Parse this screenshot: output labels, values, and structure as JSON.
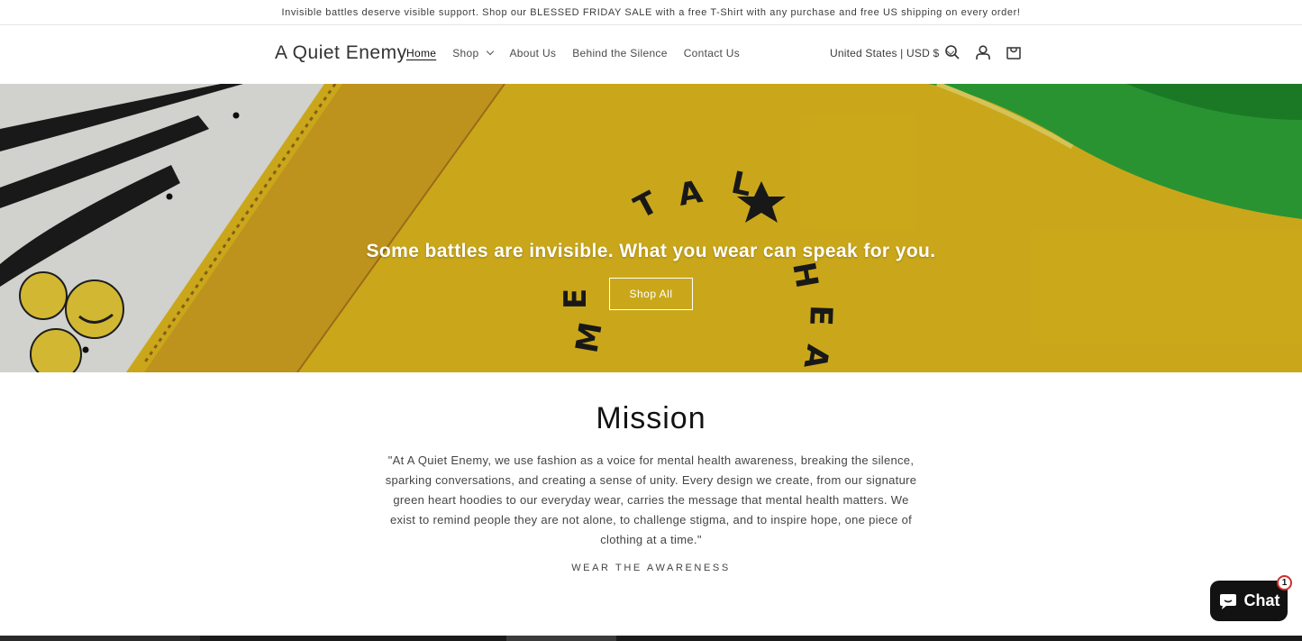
{
  "announcement": {
    "text": "Invisible battles deserve visible support. Shop our BLESSED FRIDAY SALE with a free T-Shirt with any purchase and free US shipping on every order!"
  },
  "header": {
    "logo": "A Quiet Enemy",
    "nav": [
      {
        "label": "Home",
        "active": true
      },
      {
        "label": "Shop",
        "has_dropdown": true
      },
      {
        "label": "About Us"
      },
      {
        "label": "Behind the Silence"
      },
      {
        "label": "Contact Us"
      }
    ],
    "localization": "United States | USD $",
    "icons": [
      "search-icon",
      "account-icon",
      "cart-icon"
    ]
  },
  "hero": {
    "heading": "Some battles are invisible. What you wear can speak for you.",
    "button_label": "Shop All",
    "colors": {
      "yellow": "#e9c420",
      "green": "#2fa83a"
    }
  },
  "mission": {
    "title": "Mission",
    "text": "\"At A Quiet Enemy, we use fashion as a voice for mental health awareness, breaking the silence, sparking conversations, and creating a sense of unity. Every design we create, from our signature green heart hoodies to our everyday wear, carries the message that mental health matters. We exist to remind people they are not alone, to challenge stigma, and to inspire hope, one piece of clothing at a time.\"",
    "link": "WEAR THE AWARENESS"
  },
  "chat": {
    "label": "Chat",
    "badge": "1",
    "color": "#121212"
  }
}
